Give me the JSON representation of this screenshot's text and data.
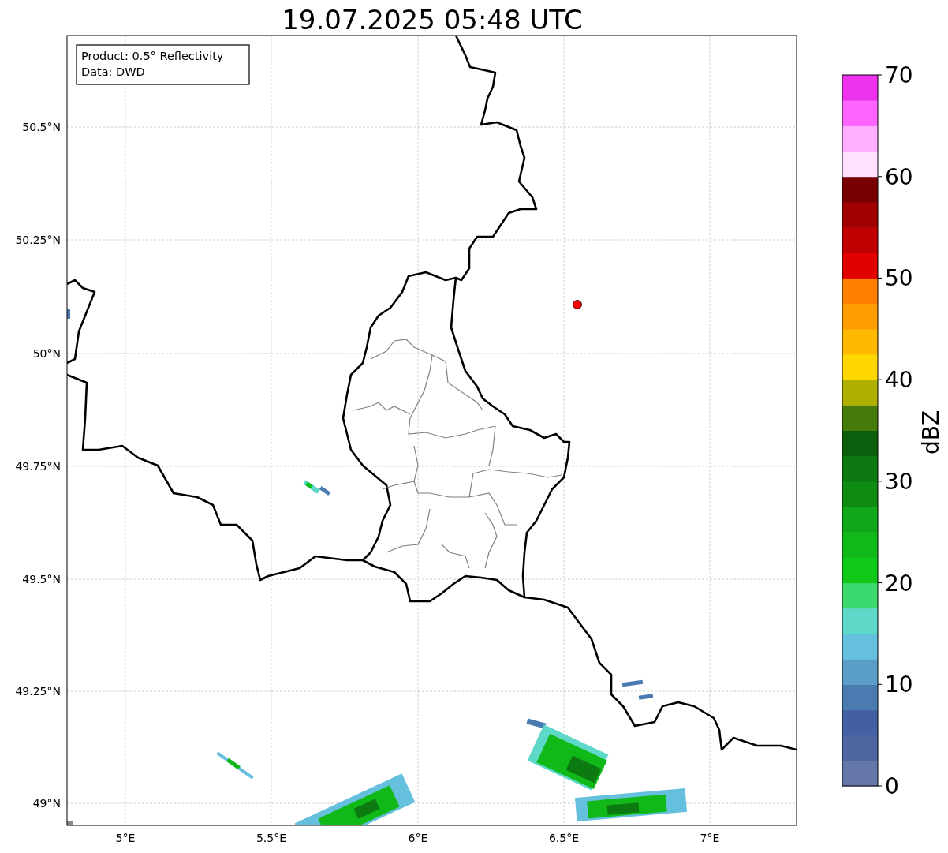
{
  "title": "19.07.2025 05:48 UTC",
  "info_box": [
    "Product: 0.5° Reflectivity",
    "Data: DWD"
  ],
  "lat_ticks": [
    "50.5°N",
    "50.25°N",
    "50°N",
    "49.75°N",
    "49.5°N",
    "49.25°N",
    "49°N"
  ],
  "lon_ticks": [
    "5°E",
    "5.5°E",
    "6°E",
    "6.5°E",
    "7°E"
  ],
  "colorbar": {
    "label": "dBZ",
    "ticks": [
      "70",
      "60",
      "50",
      "40",
      "30",
      "20",
      "10",
      "0"
    ],
    "bins": [
      {
        "color": "#6677aa"
      },
      {
        "color": "#5066a0"
      },
      {
        "color": "#4460a4"
      },
      {
        "color": "#4a7bb0"
      },
      {
        "color": "#5a9ec8"
      },
      {
        "color": "#64c0dc"
      },
      {
        "color": "#5ed8c8"
      },
      {
        "color": "#3cd870"
      },
      {
        "color": "#10c818"
      },
      {
        "color": "#10b818"
      },
      {
        "color": "#10a818"
      },
      {
        "color": "#0e8c12"
      },
      {
        "color": "#0c7a10"
      },
      {
        "color": "#0a5e0c"
      },
      {
        "color": "#467a0a"
      },
      {
        "color": "#b0b000"
      },
      {
        "color": "#ffd700"
      },
      {
        "color": "#ffb900"
      },
      {
        "color": "#ff9c00"
      },
      {
        "color": "#ff7f00"
      },
      {
        "color": "#e00000"
      },
      {
        "color": "#c00000"
      },
      {
        "color": "#a00000"
      },
      {
        "color": "#780000"
      },
      {
        "color": "#ffe0ff"
      },
      {
        "color": "#ffb0ff"
      },
      {
        "color": "#ff64ff"
      },
      {
        "color": "#ee33ee"
      }
    ]
  }
}
